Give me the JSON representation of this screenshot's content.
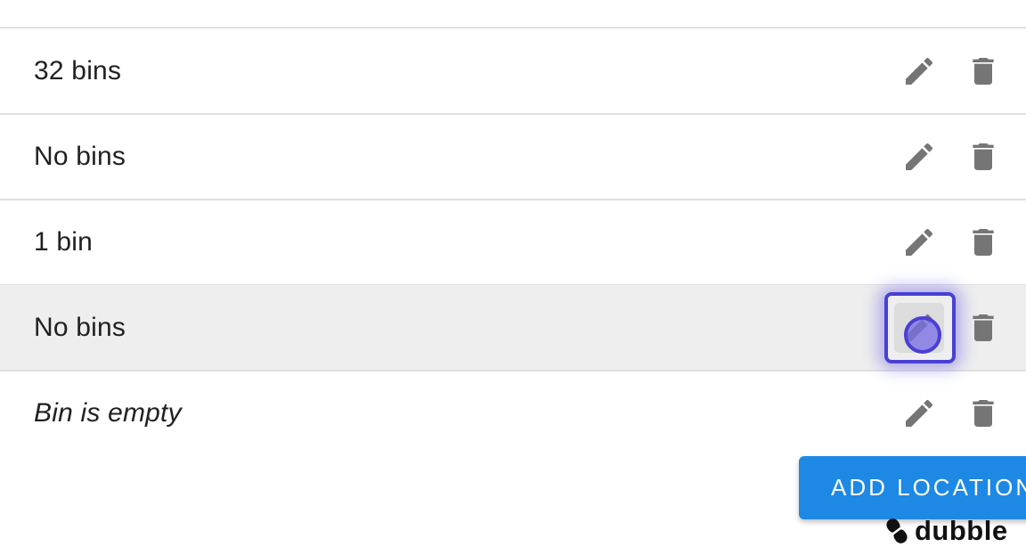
{
  "locations": [
    {
      "label": "",
      "italic": false
    },
    {
      "label": "32 bins",
      "italic": false
    },
    {
      "label": "No bins",
      "italic": false
    },
    {
      "label": "1 bin",
      "italic": false
    },
    {
      "label": "No bins",
      "italic": false,
      "selected": true
    },
    {
      "label": "Bin is empty",
      "italic": true
    }
  ],
  "icons": {
    "edit": "pencil-icon",
    "delete": "trash-icon"
  },
  "actions": {
    "add_location_label": "ADD LOCATION"
  },
  "brand": {
    "name": "dubble"
  },
  "colors": {
    "icon": "#757575",
    "divider": "#e0e0e0",
    "selected_row": "#eeeeee",
    "primary_button": "#1e88e5",
    "focus_ring": "#4a3fd6"
  }
}
